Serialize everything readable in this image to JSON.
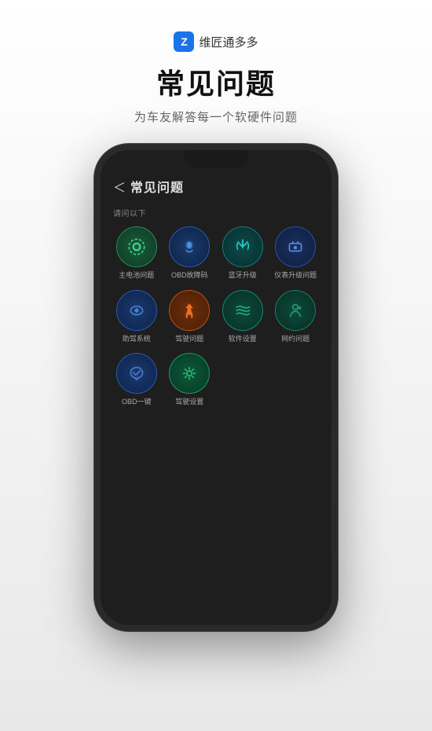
{
  "header": {
    "app_icon_text": "Z",
    "app_name": "维匠通多多",
    "page_title": "常见问题",
    "page_subtitle": "为车友解答每一个软硬件问题"
  },
  "phone": {
    "back_arrow": "＜",
    "back_title": "常见问题",
    "section_label": "请问以下",
    "grid_items": [
      {
        "icon": "⚙",
        "label": "主电池问题",
        "color_class": "icon-green-dark"
      },
      {
        "icon": "🔵",
        "label": "OBD故障码",
        "color_class": "icon-blue"
      },
      {
        "icon": "⚡",
        "label": "蓝牙升级",
        "color_class": "icon-teal"
      },
      {
        "icon": "📶",
        "label": "仪表升级问题",
        "color_class": "icon-blue2"
      },
      {
        "icon": "👁",
        "label": "助驾系统",
        "color_class": "icon-blue3"
      },
      {
        "icon": "🏠",
        "label": "驾驶问题",
        "color_class": "icon-orange"
      },
      {
        "icon": "🚗",
        "label": "软件设置",
        "color_class": "icon-green2"
      },
      {
        "icon": "🚴",
        "label": "网约问题",
        "color_class": "icon-teal2"
      },
      {
        "icon": "☁",
        "label": "OBD一键",
        "color_class": "icon-blue4"
      },
      {
        "icon": "⚙",
        "label": "驾驶设置",
        "color_class": "icon-green3"
      }
    ]
  }
}
